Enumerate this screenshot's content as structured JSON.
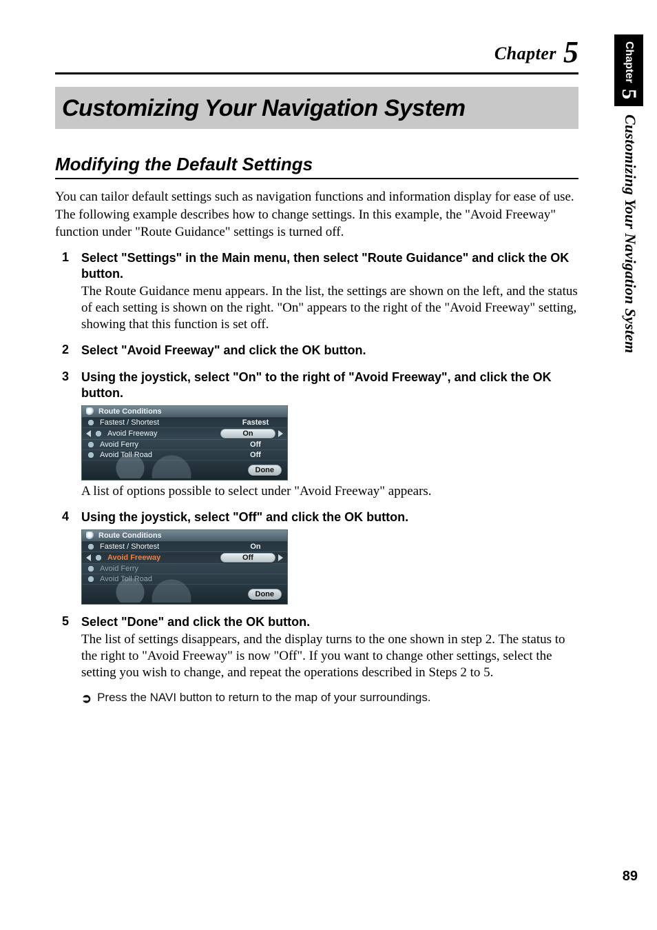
{
  "chapter": {
    "label": "Chapter",
    "number": "5"
  },
  "page_title": "Customizing Your Navigation System",
  "section_heading": "Modifying the Default Settings",
  "intro": {
    "p1": "You can tailor default settings such as navigation functions and information display for ease of use.",
    "p2": "The following example describes how to change settings. In this example, the \"Avoid Freeway\" function under \"Route Guidance\" settings is turned off."
  },
  "steps": [
    {
      "num": "1",
      "title": "Select \"Settings\" in the Main menu, then select \"Route Guidance\" and click the OK button.",
      "desc": "The Route Guidance menu appears. In the list, the settings are shown on the left, and the status of each setting is shown on the right. \"On\" appears to the right of the \"Avoid Freeway\" setting, showing that this function is set off."
    },
    {
      "num": "2",
      "title": "Select \"Avoid Freeway\" and click the OK button."
    },
    {
      "num": "3",
      "title": "Using the joystick, select \"On\" to the right of \"Avoid Freeway\", and click the OK button.",
      "after": "A list of options possible to select under \"Avoid Freeway\" appears."
    },
    {
      "num": "4",
      "title": "Using the joystick, select \"Off\" and click the OK button."
    },
    {
      "num": "5",
      "title": "Select \"Done\" and click the OK button.",
      "desc": "The list of settings disappears, and the display turns to the one shown in step 2. The status to the right to \"Avoid Freeway\" is now \"Off\". If you want to change other settings, select the setting you wish to change, and repeat the operations described in Steps 2 to 5."
    }
  ],
  "screens": {
    "a": {
      "title": "Route Conditions",
      "rows": [
        {
          "label": "Fastest / Shortest",
          "value": "Fastest",
          "pill": false
        },
        {
          "label": "Avoid Freeway",
          "value": "On",
          "pill": true
        },
        {
          "label": "Avoid Ferry",
          "value": "Off",
          "pill": false
        },
        {
          "label": "Avoid Toll Road",
          "value": "Off",
          "pill": false
        }
      ],
      "done": "Done"
    },
    "b": {
      "title": "Route Conditions",
      "rows": [
        {
          "label": "Fastest / Shortest",
          "value": "On",
          "dim": false
        },
        {
          "label": "Avoid Freeway",
          "value": "Off",
          "pill": true,
          "highlight": true
        },
        {
          "label": "Avoid Ferry",
          "value": "",
          "dim": true
        },
        {
          "label": "Avoid Toll Road",
          "value": "",
          "dim": true
        }
      ],
      "done": "Done"
    }
  },
  "hint": {
    "icon": "➲",
    "text": "Press the NAVI button to return to the map of your surroundings."
  },
  "side_tab": {
    "label": "Chapter",
    "number": "5",
    "title": "Customizing Your Navigation System"
  },
  "page_number": "89"
}
